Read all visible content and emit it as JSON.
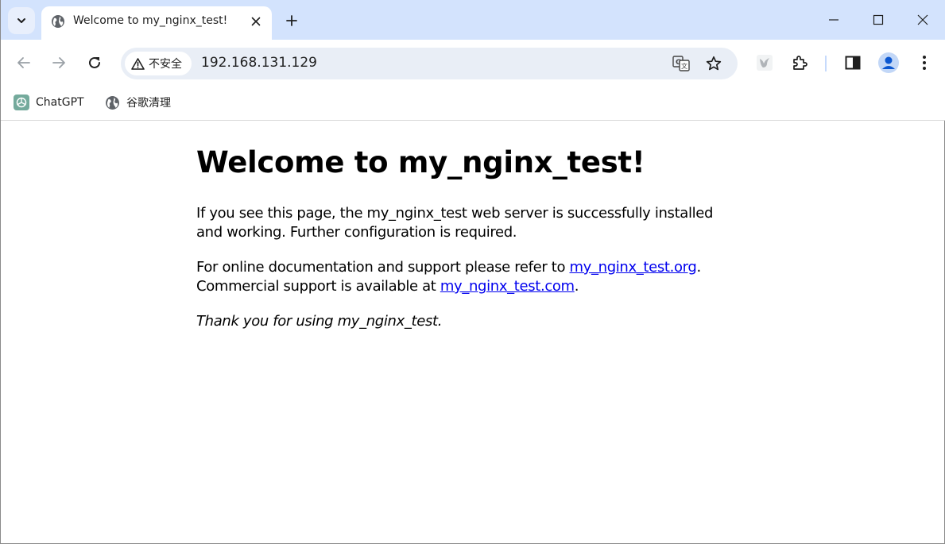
{
  "browser": {
    "tab": {
      "title": "Welcome to my_nginx_test!",
      "favicon": "globe-icon",
      "close_icon": "close-icon"
    },
    "new_tab_icon": "plus-icon",
    "tab_search_icon": "chevron-down-icon",
    "window_controls": [
      "minimize-icon",
      "maximize-icon",
      "close-icon"
    ],
    "toolbar": {
      "back_icon": "arrow-left-icon",
      "forward_icon": "arrow-right-icon",
      "reload_icon": "reload-icon",
      "security_label": "不安全",
      "security_icon": "warning-triangle-icon",
      "url": "192.168.131.129",
      "translate_icon": "translate-icon",
      "bookmark_star_icon": "star-icon",
      "extension_bird_icon": "bird-icon",
      "extensions_icon": "puzzle-icon",
      "side_panel_icon": "side-panel-icon",
      "profile_icon": "person-icon",
      "menu_icon": "kebab-menu-icon"
    },
    "bookmarks": [
      {
        "label": "ChatGPT",
        "icon": "chatgpt-icon"
      },
      {
        "label": "谷歌清理",
        "icon": "globe-icon"
      }
    ],
    "colors": {
      "tabstrip": "#d3e3fd",
      "omnibox": "#e9eef6",
      "link": "#0000ee"
    }
  },
  "page": {
    "heading": "Welcome to my_nginx_test!",
    "p1": "If you see this page, the my_nginx_test web server is successfully installed and working. Further configuration is required.",
    "p2_prefix": "For online documentation and support please refer to ",
    "p2_link1": "my_nginx_test.org",
    "p2_middle": ".",
    "p2_line2_prefix": "Commercial support is available at ",
    "p2_link2": "my_nginx_test.com",
    "p2_suffix": ".",
    "p3": "Thank you for using my_nginx_test."
  }
}
